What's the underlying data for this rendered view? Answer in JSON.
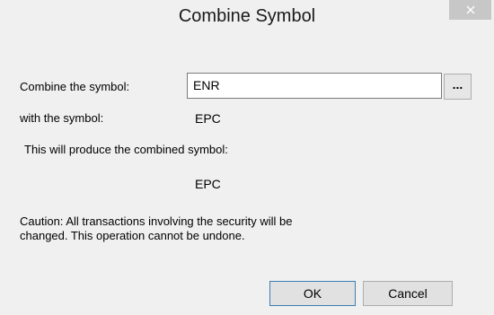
{
  "window": {
    "title": "Combine Symbol",
    "close_icon": "close-icon"
  },
  "form": {
    "combine_label": "Combine the symbol:",
    "combine_value": "ENR",
    "browse_label": "...",
    "with_label": "with the symbol:",
    "with_value": "EPC",
    "produce_label": "This will produce the combined symbol:",
    "produce_value": "EPC",
    "caution_line1": "Caution:  All transactions involving the security will be",
    "caution_line2": "changed.  This operation cannot be undone."
  },
  "buttons": {
    "ok_label": "OK",
    "cancel_label": "Cancel"
  }
}
